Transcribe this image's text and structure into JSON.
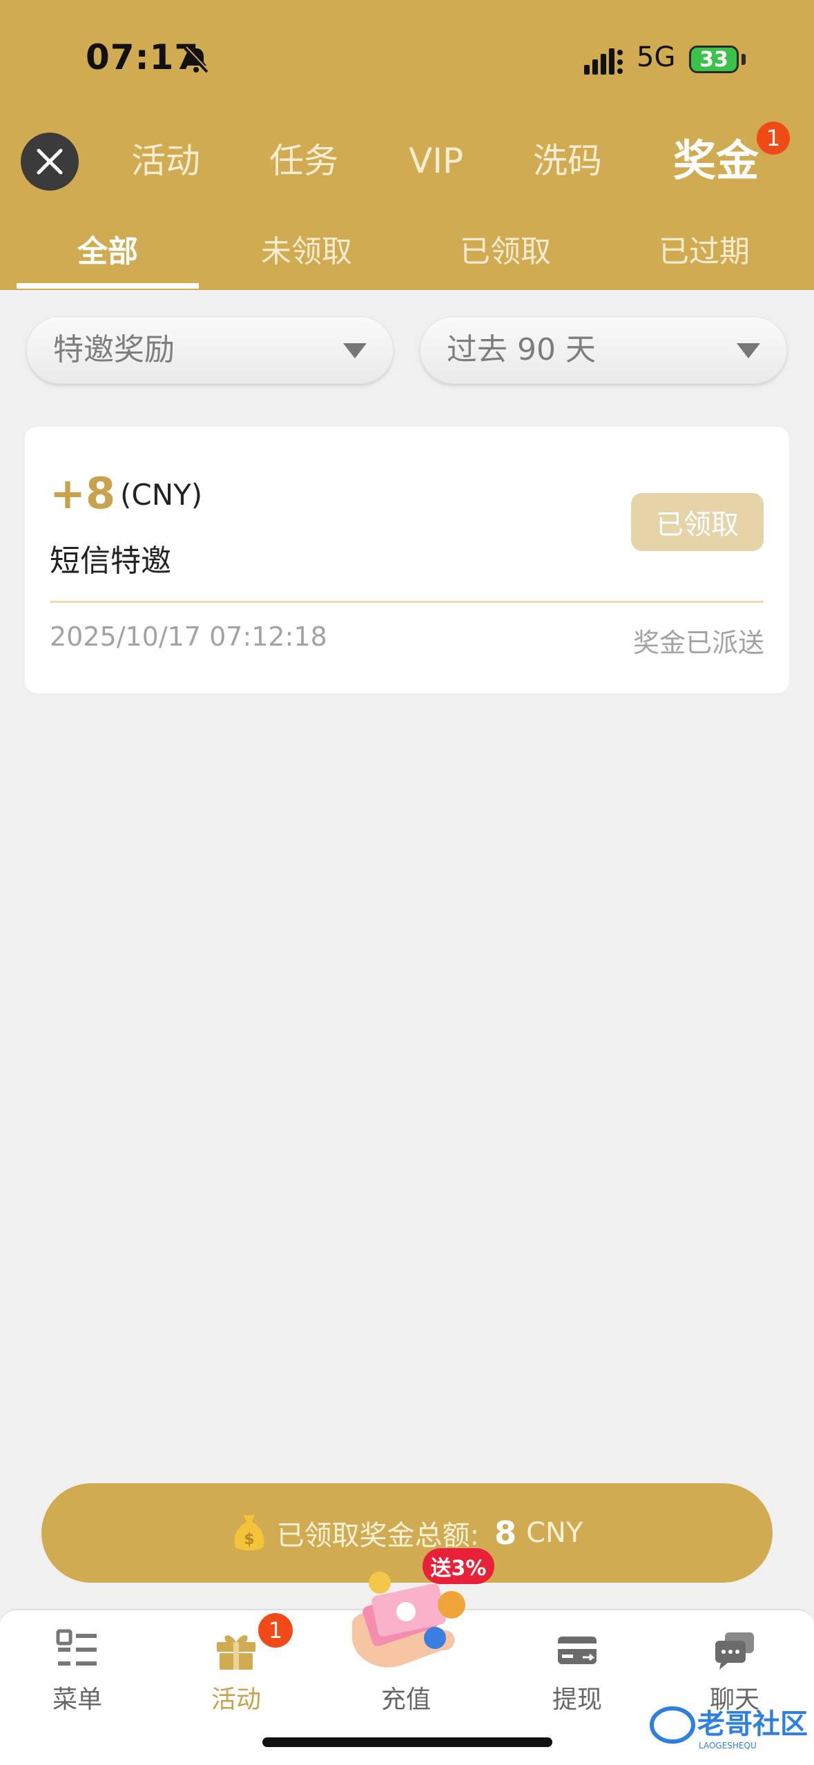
{
  "status_bar": {
    "time": "07:17",
    "network": "5G",
    "battery": "33"
  },
  "top_nav": {
    "items": [
      {
        "label": "活动"
      },
      {
        "label": "任务"
      },
      {
        "label": "VIP"
      },
      {
        "label": "洗码"
      },
      {
        "label": "奖金"
      }
    ],
    "active": "奖金",
    "badge": "1"
  },
  "sub_tabs": {
    "items": [
      {
        "label": "全部"
      },
      {
        "label": "未领取"
      },
      {
        "label": "已领取"
      },
      {
        "label": "已过期"
      }
    ],
    "active": "全部"
  },
  "filters": {
    "type": {
      "value": "特邀奖励"
    },
    "period": {
      "value": "过去 90 天"
    }
  },
  "records": [
    {
      "amount": "+8",
      "currency": "(CNY)",
      "title": "短信特邀",
      "button": "已领取",
      "time": "2025/10/17 07:12:18",
      "status": "奖金已派送"
    }
  ],
  "total": {
    "label": "已领取奖金总额:",
    "value": "8",
    "currency": "CNY"
  },
  "bottom_nav": {
    "items": [
      {
        "label": "菜单",
        "icon": "menu-icon"
      },
      {
        "label": "活动",
        "icon": "gift-icon"
      },
      {
        "label": "充值",
        "icon": "deposit-icon"
      },
      {
        "label": "提现",
        "icon": "withdraw-icon"
      },
      {
        "label": "聊天",
        "icon": "chat-icon"
      }
    ],
    "active": "活动",
    "badge": "1",
    "promo_tag": "送3%"
  },
  "watermark": {
    "text": "老哥社区",
    "sub": "LAOGESHEQU"
  },
  "colors": {
    "brand_gold": "#d1ab51",
    "badge_red": "#f04a18",
    "claimed_button": "#e6d4a9"
  }
}
